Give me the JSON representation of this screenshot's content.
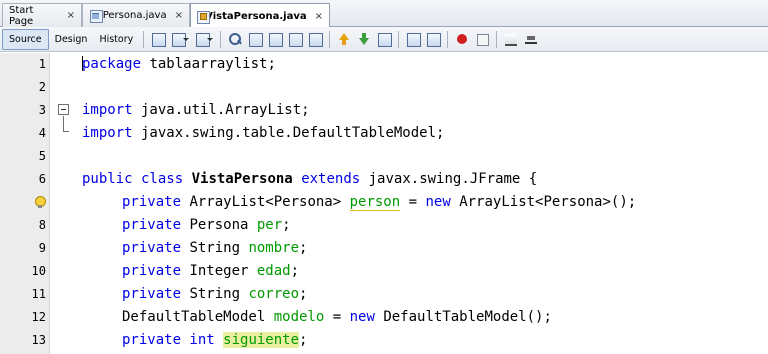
{
  "tabs": [
    {
      "label": "Start Page",
      "active": false
    },
    {
      "label": "Persona.java",
      "active": false
    },
    {
      "label": "VistaPersona.java",
      "active": true
    }
  ],
  "tab_close_glyph": "×",
  "toolbar": {
    "source_label": "Source",
    "design_label": "Design",
    "history_label": "History"
  },
  "editor": {
    "lines": [
      {
        "num": "1"
      },
      {
        "num": "2"
      },
      {
        "num": "3"
      },
      {
        "num": "4"
      },
      {
        "num": "5"
      },
      {
        "num": "6"
      },
      {
        "num": ""
      },
      {
        "num": "8"
      },
      {
        "num": "9"
      },
      {
        "num": "10"
      },
      {
        "num": "11"
      },
      {
        "num": "12"
      },
      {
        "num": "13"
      }
    ],
    "code": {
      "l1_kw": "package",
      "l1_rest": " tablaarraylist;",
      "l3_kw": "import",
      "l3_rest": " java.util.ArrayList;",
      "l4_kw": "import",
      "l4_rest": " javax.swing.table.DefaultTableModel;",
      "l6_kw1": "public class",
      "l6_cls": "VistaPersona",
      "l6_kw2": "extends",
      "l6_rest": " javax.swing.JFrame {",
      "l7_kw": "private",
      "l7_type": " ArrayList<Persona> ",
      "l7_fld": "person",
      "l7_eq": " = ",
      "l7_new": "new",
      "l7_rest": " ArrayList<Persona>();",
      "l8_kw": "private",
      "l8_type": " Persona ",
      "l8_fld": "per",
      "l8_end": ";",
      "l9_kw": "private",
      "l9_type": " String ",
      "l9_fld": "nombre",
      "l9_end": ";",
      "l10_kw": "private",
      "l10_type": " Integer ",
      "l10_fld": "edad",
      "l10_end": ";",
      "l11_kw": "private",
      "l11_type": " String ",
      "l11_fld": "correo",
      "l11_end": ";",
      "l12_type": "DefaultTableModel ",
      "l12_fld": "modelo",
      "l12_eq": " = ",
      "l12_new": "new",
      "l12_rest": " DefaultTableModel();",
      "l13_kw": "private int",
      "l13_fld": "siguiente",
      "l13_end": ";"
    }
  },
  "colors": {
    "keyword": "#0000e6",
    "field": "#009900",
    "highlight": "#e9efa0"
  },
  "icons": [
    "start-page-tab",
    "java-file-icon",
    "form-file-icon",
    "close-icon",
    "lightbulb-warning-icon",
    "fold-icon"
  ]
}
